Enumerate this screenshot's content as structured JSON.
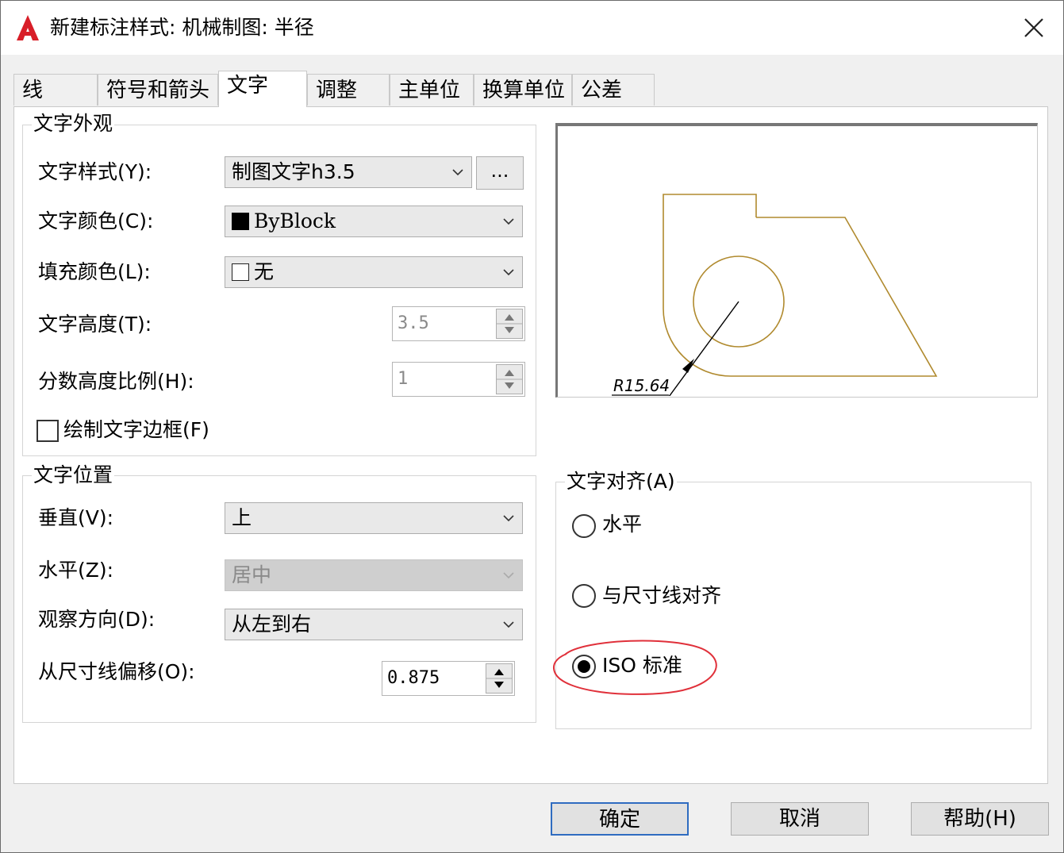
{
  "window": {
    "title": "新建标注样式: 机械制图: 半径"
  },
  "tabs": [
    {
      "label": "线"
    },
    {
      "label": "符号和箭头"
    },
    {
      "label": "文字"
    },
    {
      "label": "调整"
    },
    {
      "label": "主单位"
    },
    {
      "label": "换算单位"
    },
    {
      "label": "公差"
    }
  ],
  "active_tab": "文字",
  "appearance": {
    "legend": "文字外观",
    "text_style": {
      "label": "文字样式(Y):",
      "value": "制图文字h3.5",
      "browse_label": "..."
    },
    "text_color": {
      "label": "文字颜色(C):",
      "value": "ByBlock",
      "swatch": "#000000"
    },
    "fill_color": {
      "label": "填充颜色(L):",
      "value": "无",
      "swatch": "#ffffff"
    },
    "text_height": {
      "label": "文字高度(T):",
      "value": "3.5"
    },
    "fraction_scale": {
      "label": "分数高度比例(H):",
      "value": "1"
    },
    "draw_frame": {
      "label": "绘制文字边框(F)",
      "checked": false
    }
  },
  "placement": {
    "legend": "文字位置",
    "vertical": {
      "label": "垂直(V):",
      "value": "上"
    },
    "horizontal": {
      "label": "水平(Z):",
      "value": "居中",
      "disabled": true
    },
    "view_direction": {
      "label": "观察方向(D):",
      "value": "从左到右"
    },
    "offset": {
      "label": "从尺寸线偏移(O):",
      "value": "0.875"
    }
  },
  "preview": {
    "dimension_text": "R15.64",
    "line_color": "#b08a2e"
  },
  "alignment": {
    "legend": "文字对齐(A)",
    "options": [
      {
        "label": "水平",
        "checked": false
      },
      {
        "label": "与尺寸线对齐",
        "checked": false
      },
      {
        "label": "ISO 标准",
        "checked": true
      }
    ],
    "highlight_color": "#e0303a"
  },
  "buttons": {
    "ok": "确定",
    "cancel": "取消",
    "help": "帮助(H)"
  }
}
